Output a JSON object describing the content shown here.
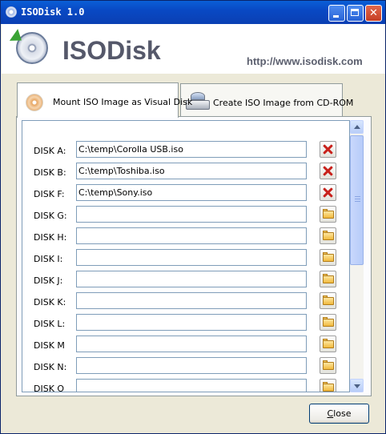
{
  "window": {
    "title": "ISODisk 1.0"
  },
  "header": {
    "logo_text": "ISODisk",
    "url": "http://www.isodisk.com"
  },
  "tabs": [
    {
      "label": "Mount ISO Image as Visual Disk",
      "active": true,
      "icon": "disc-icon"
    },
    {
      "label": "Create ISO Image from CD-ROM",
      "active": false,
      "icon": "cd-drive-icon"
    }
  ],
  "disks": [
    {
      "label": "DISK A:",
      "path": "C:\\temp\\Corolla USB.iso",
      "action": "unmount"
    },
    {
      "label": "DISK B:",
      "path": "C:\\temp\\Toshiba.iso",
      "action": "unmount"
    },
    {
      "label": "DISK F:",
      "path": "C:\\temp\\Sony.iso",
      "action": "unmount"
    },
    {
      "label": "DISK G:",
      "path": "",
      "action": "browse"
    },
    {
      "label": "DISK H:",
      "path": "",
      "action": "browse"
    },
    {
      "label": "DISK I:",
      "path": "",
      "action": "browse"
    },
    {
      "label": "DISK J:",
      "path": "",
      "action": "browse"
    },
    {
      "label": "DISK K:",
      "path": "",
      "action": "browse"
    },
    {
      "label": "DISK L:",
      "path": "",
      "action": "browse"
    },
    {
      "label": "DISK M",
      "path": "",
      "action": "browse"
    },
    {
      "label": "DISK N:",
      "path": "",
      "action": "browse"
    },
    {
      "label": "DISK O",
      "path": "",
      "action": "browse"
    }
  ],
  "buttons": {
    "close_mnemonic": "C",
    "close_rest": "lose"
  },
  "colors": {
    "titlebar": "#0A49C4",
    "unmount": "#C8211B",
    "folder": "#F0B93D"
  }
}
